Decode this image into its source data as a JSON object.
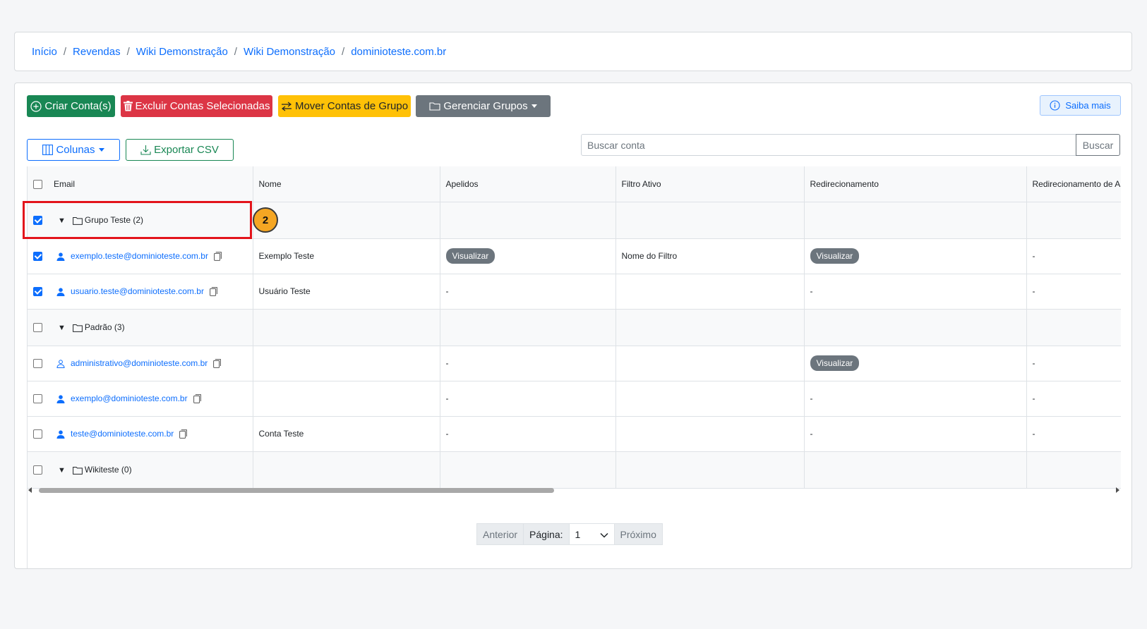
{
  "breadcrumb": {
    "items": [
      "Início",
      "Revendas",
      "Wiki Demonstração",
      "Wiki Demonstração",
      "dominioteste.com.br"
    ],
    "separator": "/"
  },
  "toolbar": {
    "create_label": "Criar Conta(s)",
    "delete_label": "Excluir Contas Selecionadas",
    "move_label": "Mover Contas de Grupo",
    "manage_groups_label": "Gerenciar Grupos",
    "learn_more_label": "Saiba mais",
    "columns_label": "Colunas",
    "export_label": "Exportar CSV"
  },
  "search": {
    "placeholder": "Buscar conta",
    "button_label": "Buscar"
  },
  "table": {
    "headers": [
      "Email",
      "Nome",
      "Apelidos",
      "Filtro Ativo",
      "Redirecionamento",
      "Redirecionamento de Ar"
    ],
    "rows": [
      {
        "type": "group",
        "label": "Grupo Teste (2)",
        "checked": true
      },
      {
        "type": "account",
        "email": "exemplo.teste@dominioteste.com.br",
        "nome": "Exemplo Teste",
        "apelidos": "Visualizar",
        "filtro": "Nome do Filtro",
        "redir": "Visualizar",
        "redir2": "-",
        "checked": true
      },
      {
        "type": "account",
        "email": "usuario.teste@dominioteste.com.br",
        "nome": "Usuário Teste",
        "apelidos": "-",
        "filtro": "",
        "redir": "-",
        "redir2": "-",
        "checked": true
      },
      {
        "type": "group",
        "label": "Padrão (3)",
        "checked": false
      },
      {
        "type": "account",
        "email": "administrativo@dominioteste.com.br",
        "nome": "",
        "apelidos": "-",
        "filtro": "",
        "redir": "Visualizar",
        "redir2": "-",
        "checked": false
      },
      {
        "type": "account",
        "email": "exemplo@dominioteste.com.br",
        "nome": "",
        "apelidos": "-",
        "filtro": "",
        "redir": "-",
        "redir2": "-",
        "checked": false
      },
      {
        "type": "account",
        "email": "teste@dominioteste.com.br",
        "nome": "Conta Teste",
        "apelidos": "-",
        "filtro": "",
        "redir": "-",
        "redir2": "-",
        "checked": false
      },
      {
        "type": "group",
        "label": "Wikiteste (0)",
        "checked": false
      }
    ]
  },
  "pagination": {
    "prev_label": "Anterior",
    "page_label": "Página:",
    "page_value": "1",
    "next_label": "Próximo"
  },
  "annotation": {
    "step_number": "2"
  },
  "colors": {
    "primary": "#0d6efd",
    "success": "#198754",
    "danger": "#dc3545",
    "warning": "#ffc107",
    "secondary": "#6c757d",
    "highlight": "#e3141b",
    "step_badge": "#f5a623"
  }
}
